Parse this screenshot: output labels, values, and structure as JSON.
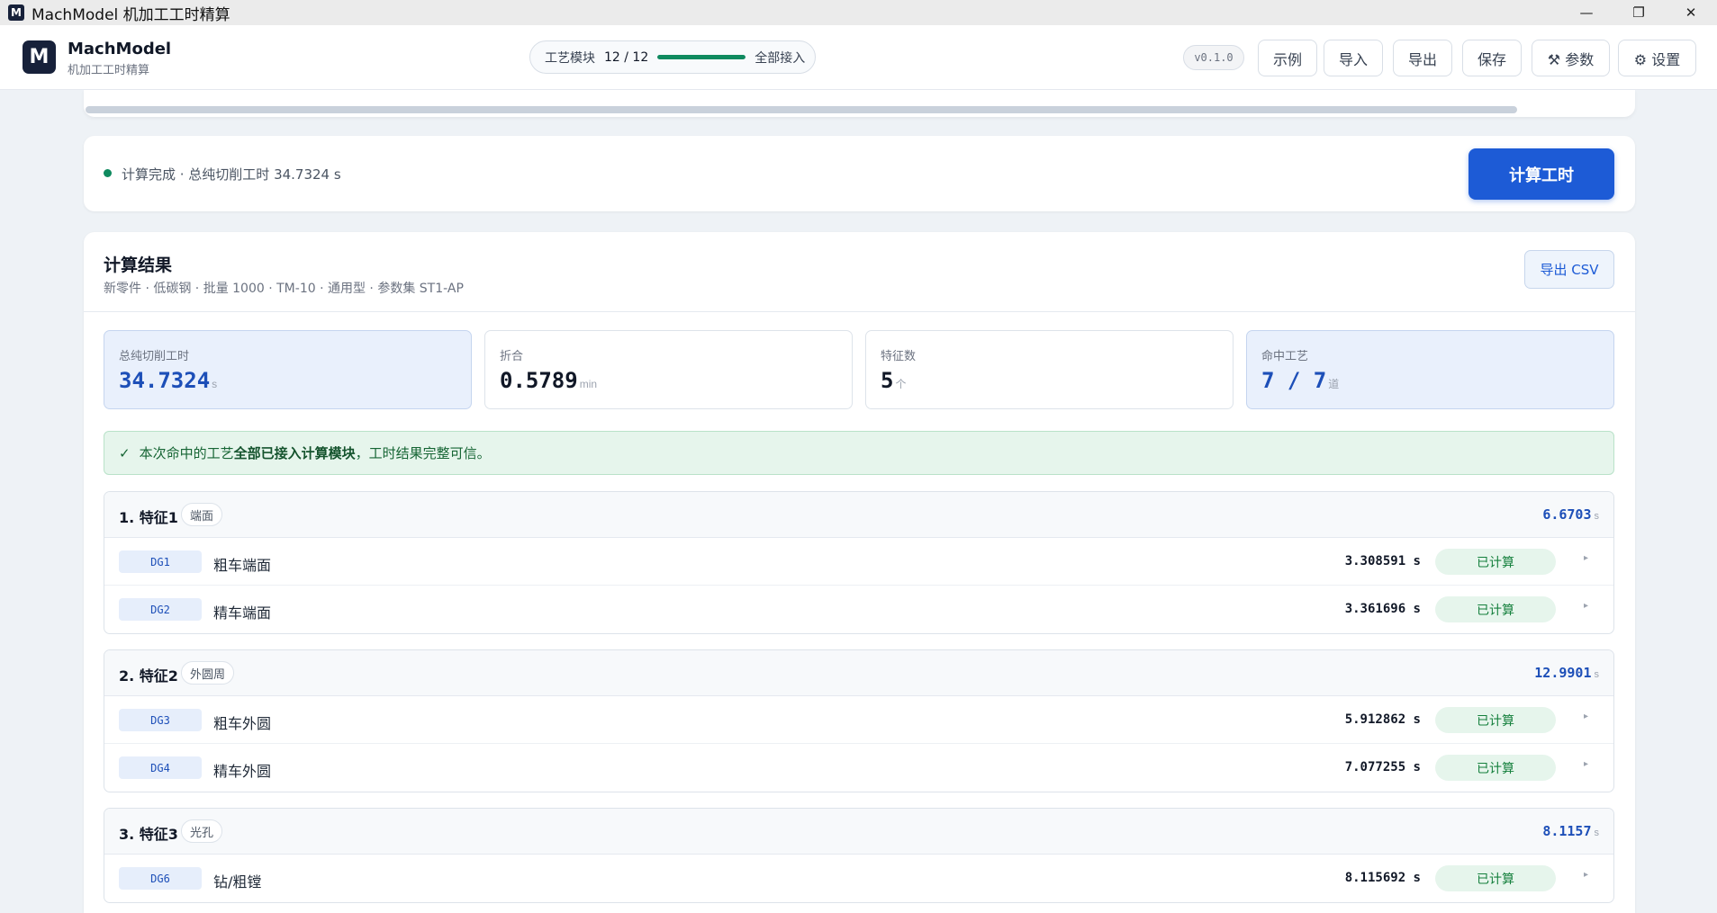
{
  "window": {
    "icon": "M",
    "title": "MachModel 机加工工时精算",
    "controls": [
      "—",
      "❐",
      "✕"
    ]
  },
  "header": {
    "logo_letter": "M",
    "brand_name": "MachModel",
    "brand_sub": "机加工工时精算",
    "modules": {
      "label": "工艺模块",
      "count": "12 / 12",
      "progress": 1.0,
      "status": "全部接入"
    },
    "version": "v0.1.0",
    "buttons": {
      "example": "示例",
      "import": "导入",
      "export": "导出",
      "save": "保存",
      "params": "⚒ 参数",
      "settings": "⚙ 设置"
    }
  },
  "action": {
    "status": "计算完成 · 总纯切削工时 34.7324 s",
    "calc_button": "计算工时"
  },
  "results": {
    "title": "计算结果",
    "subtitle": "新零件 · 低碳钢 · 批量 1000 · TM-10 · 通用型 · 参数集 ST1-AP",
    "export_csv": "导出 CSV",
    "stats": [
      {
        "label": "总纯切削工时",
        "value": "34.7324",
        "unit": "s"
      },
      {
        "label": "折合",
        "value": "0.5789",
        "unit": "min"
      },
      {
        "label": "特征数",
        "value": "5",
        "unit": "个"
      },
      {
        "label": "命中工艺",
        "value": "7 / 7",
        "unit": "道"
      }
    ],
    "notice": {
      "check": "✓",
      "pre": "本次命中的工艺",
      "bold": "全部已接入计算模块",
      "post": "，工时结果完整可信。"
    },
    "unit_s": "s",
    "groups": [
      {
        "title": "1. 特征1",
        "tag": "端面",
        "total": "6.6703",
        "rows": [
          {
            "dg": "DG1",
            "name": "粗车端面",
            "time": "3.308591 s",
            "status": "已计算"
          },
          {
            "dg": "DG2",
            "name": "精车端面",
            "time": "3.361696 s",
            "status": "已计算"
          }
        ]
      },
      {
        "title": "2. 特征2",
        "tag": "外圆周",
        "total": "12.9901",
        "rows": [
          {
            "dg": "DG3",
            "name": "粗车外圆",
            "time": "5.912862 s",
            "status": "已计算"
          },
          {
            "dg": "DG4",
            "name": "精车外圆",
            "time": "7.077255 s",
            "status": "已计算"
          }
        ]
      },
      {
        "title": "3. 特征3",
        "tag": "光孔",
        "total": "8.1157",
        "rows": [
          {
            "dg": "DG6",
            "name": "钻/粗镗",
            "time": "8.115692 s",
            "status": "已计算"
          }
        ]
      }
    ],
    "row_arrow": "▸"
  }
}
